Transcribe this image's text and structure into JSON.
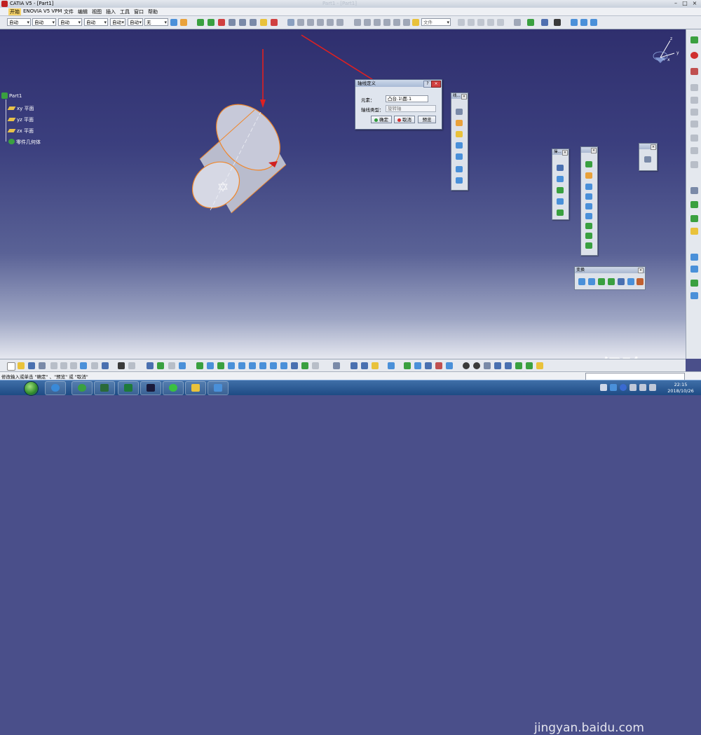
{
  "window": {
    "title": "CATIA V5 - [Part1]",
    "ghost_title": "Part1 - [Part1]",
    "minimize": "–",
    "maximize": "□",
    "close": "×"
  },
  "menu": [
    "开始",
    "ENOVIA V5 VPM",
    "文件",
    "编辑",
    "视图",
    "插入",
    "工具",
    "窗口",
    "帮助"
  ],
  "toolbar": {
    "combos": [
      "自动",
      "自动",
      "自动",
      "自动",
      "自动",
      "自动",
      "无"
    ],
    "file_combo": "文件"
  },
  "tree": {
    "root": "Part1",
    "items": [
      "xy 平面",
      "yz 平面",
      "zx 平面"
    ],
    "selected": "零件几何体"
  },
  "dialog": {
    "title": "轴线定义",
    "help": "?",
    "close": "×",
    "element_label": "元素：",
    "element_value": "凸台.1\\面.1",
    "axis_type_label": "轴线类型：",
    "axis_type_value": "旋转轴",
    "ok": "确定",
    "cancel": "取消",
    "preview": "预览"
  },
  "floating_toolbars": {
    "tb1_caption": "线...",
    "tb2_caption": "操...",
    "tb3_caption": "",
    "tb4_caption": "",
    "transform_caption": "变换",
    "close_glyph": "×"
  },
  "status": {
    "message": "修改输入或单击 \"确定\" 、\"预览\" 或 \"取消\""
  },
  "taskbar": {
    "time": "22:15",
    "date": "2018/10/26"
  },
  "watermark": {
    "logo": "Bai du 经验",
    "url": "jingyan.baidu.com"
  },
  "compass": {
    "x": "x",
    "y": "y",
    "z": "z"
  },
  "colors": {
    "highlight": "#f59a2a",
    "cylinder_edge": "#f0862a",
    "arrow": "#e02020"
  }
}
